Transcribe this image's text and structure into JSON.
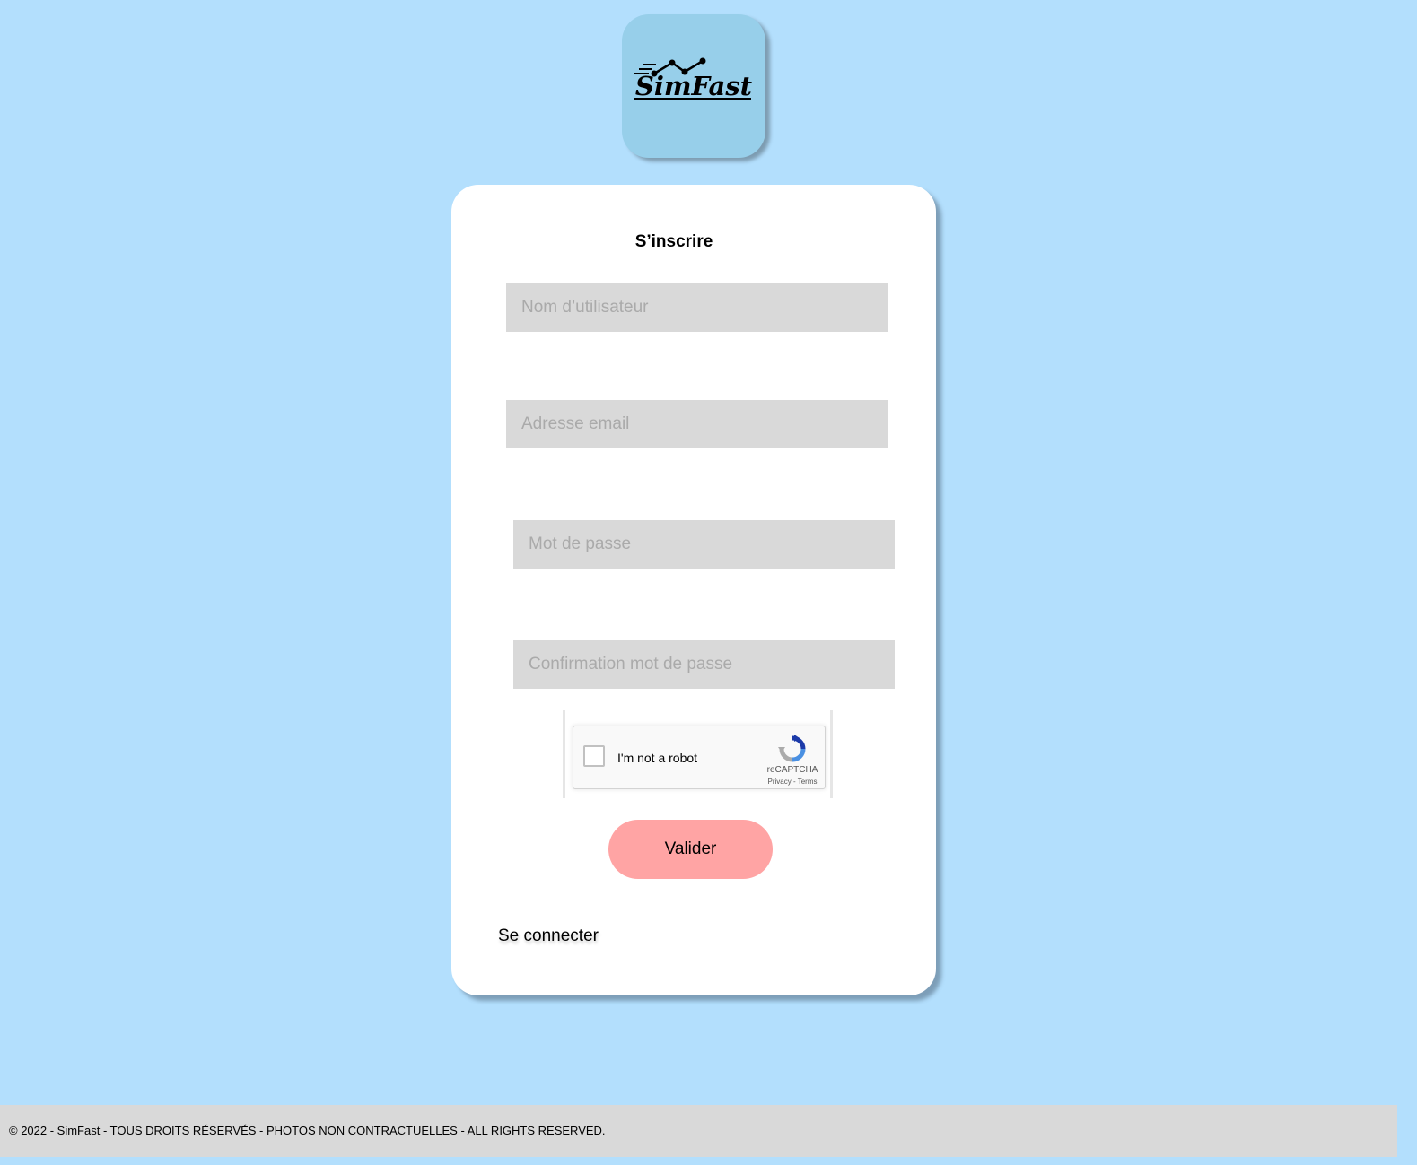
{
  "brand": {
    "logo_text": "SimFast"
  },
  "form": {
    "title": "S’inscrire",
    "fields": {
      "username_placeholder": "Nom d’utilisateur",
      "email_placeholder": "Adresse email",
      "password_placeholder": "Mot de passe",
      "password_confirm_placeholder": "Confirmation mot de passe"
    },
    "captcha": {
      "label": "I'm not a robot",
      "brand": "reCAPTCHA",
      "privacy": "Privacy",
      "separator": " - ",
      "terms": "Terms",
      "checked": false
    },
    "submit_label": "Valider",
    "login_link": "Se connecter"
  },
  "footer": {
    "text": "© 2022 - SimFast - TOUS DROITS RÉSERVÉS - PHOTOS NON CONTRACTUELLES - ALL RIGHTS RESERVED."
  },
  "colors": {
    "page_background": "#b3dffd",
    "logo_tile": "#97cfea",
    "card": "#ffffff",
    "field": "#d9d9d9",
    "submit_button": "#ffa4a4",
    "footer": "#d9d9d9"
  }
}
